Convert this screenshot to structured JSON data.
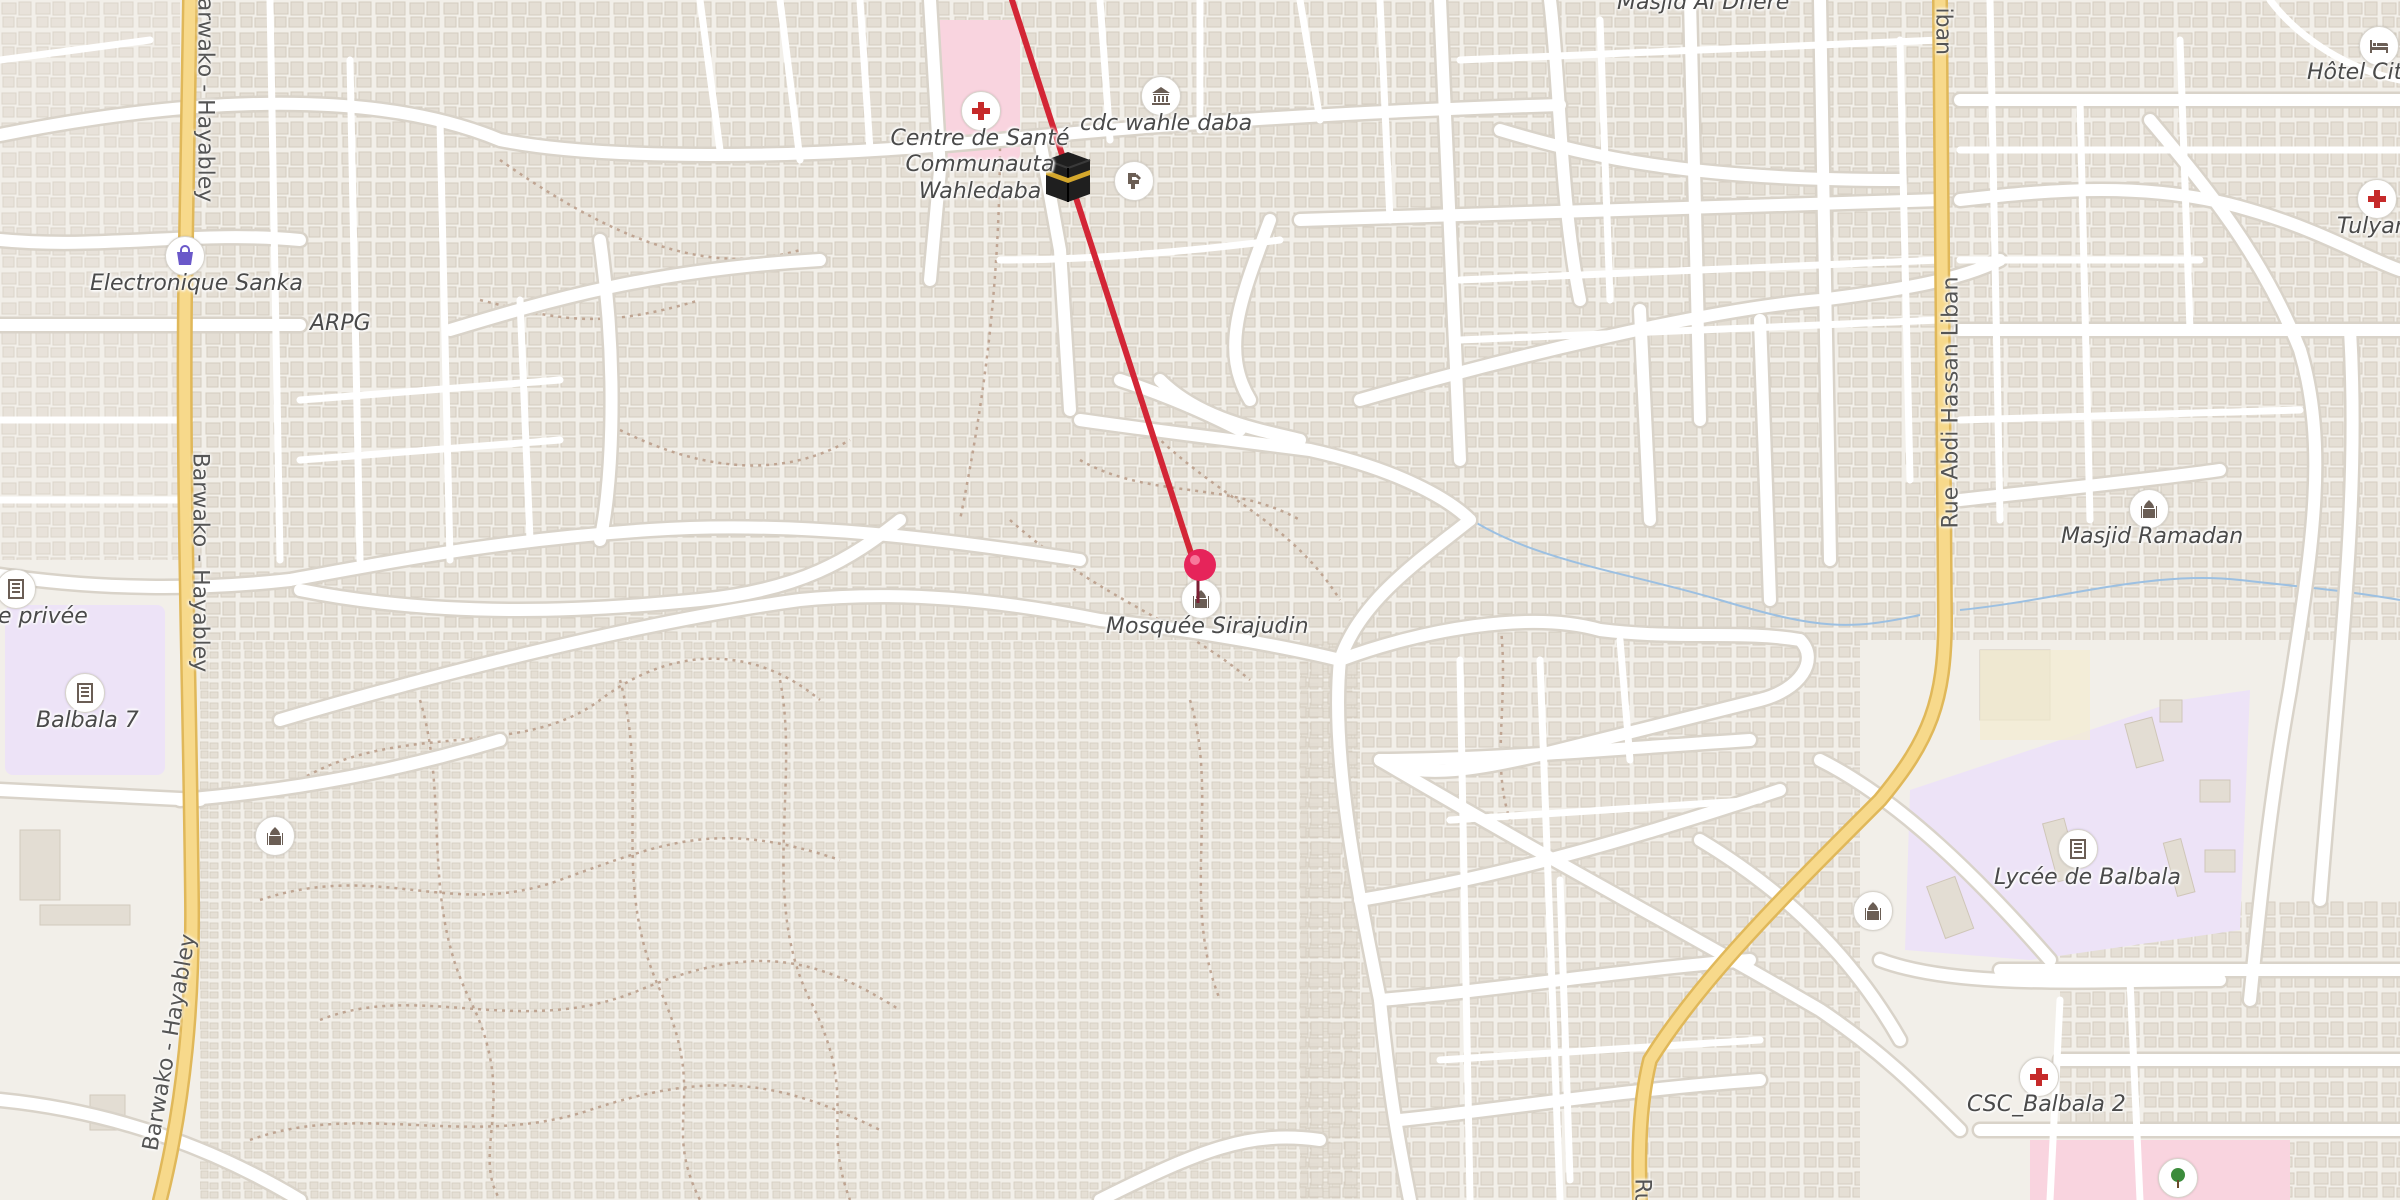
{
  "map": {
    "colors": {
      "background": "#f2efe9",
      "minor_road": "#ffffff",
      "road_casing": "#d9d3c9",
      "major_road": "#f7d98b",
      "major_road_casing": "#e0b85a",
      "building": "#e3ddd3",
      "building_stroke": "#d2cabd",
      "footpath": "#b89a86",
      "school_area": "#ede3f7",
      "hospital_area": "#f9d4df",
      "stream": "#9cc0e2",
      "route_line": "#d32636",
      "pin": "#e6245a"
    },
    "route": {
      "label": ""
    },
    "labels": {
      "top_masjid": "Masjid Al Dhere",
      "hotel": "Hôtel City",
      "cdc": "cdc wahle daba",
      "health_center_line1": "Centre de Santé",
      "health_center_line2": "Communauta",
      "health_center_line3": "Wahledaba",
      "tulyan": "Tulyan",
      "electronique": "Electronique Sanka",
      "arpg": "ARPG",
      "ecole_privee": "e privée",
      "balbala7": "Balbala 7",
      "masjid_ramadan": "Masjid Ramadan",
      "mosquee_sirajudin": "Mosquée Sirajudin",
      "lycee": "Lycée de Balbala",
      "csc": "CSC_Balbala 2"
    },
    "road_names": {
      "barwako_top": "Barwako - Hayabley",
      "barwako_mid": "Barwako - Hayabley",
      "barwako_bottom": "Barwako - Hayabley",
      "abdi_hassan": "Rue Abdi Hassan Liban",
      "rue_bottom": "Ru"
    },
    "icons": [
      "place-of-worship-icon",
      "hotel-bed-icon",
      "townhall-icon",
      "hospital-cross-icon",
      "kaaba-icon",
      "monument-icon",
      "shop-bag-icon",
      "school-icon",
      "park-tree-icon",
      "location-pin-icon"
    ]
  }
}
